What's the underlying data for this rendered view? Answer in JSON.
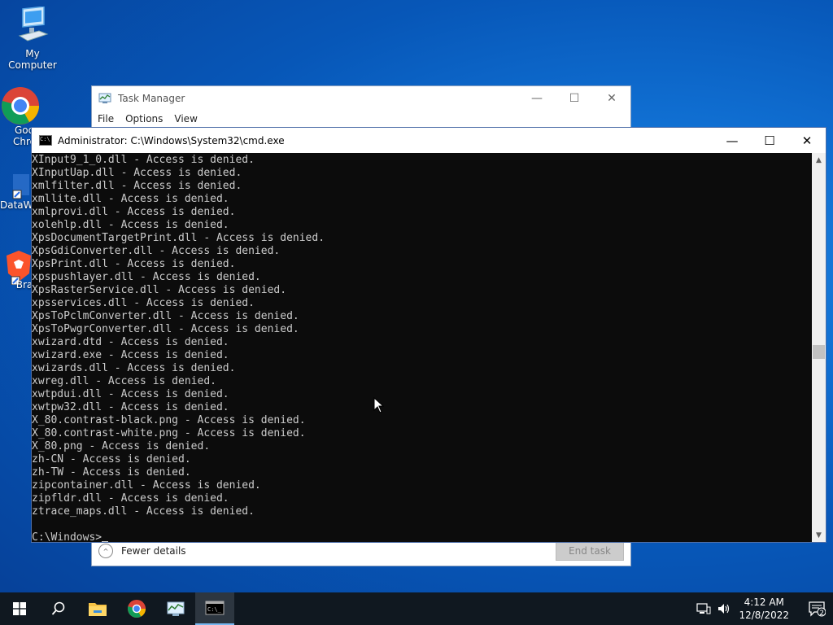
{
  "desktop": {
    "icons": [
      {
        "label": "My Computer",
        "icon": "computer-icon"
      },
      {
        "label": "Goo Chro",
        "icon": "chrome-icon"
      },
      {
        "label": "DataW",
        "icon": "datawrapper-icon"
      },
      {
        "label": "Bra",
        "icon": "brave-icon"
      }
    ]
  },
  "taskmgr": {
    "title": "Task Manager",
    "menu": [
      "File",
      "Options",
      "View"
    ],
    "fewer_details": "Fewer details",
    "end_task": "End task"
  },
  "cmd": {
    "title": "Administrator:  C:\\Windows\\System32\\cmd.exe",
    "lines": [
      "XInput9_1_0.dll - Access is denied.",
      "XInputUap.dll - Access is denied.",
      "xmlfilter.dll - Access is denied.",
      "xmllite.dll - Access is denied.",
      "xmlprovi.dll - Access is denied.",
      "xolehlp.dll - Access is denied.",
      "XpsDocumentTargetPrint.dll - Access is denied.",
      "XpsGdiConverter.dll - Access is denied.",
      "XpsPrint.dll - Access is denied.",
      "xpspushlayer.dll - Access is denied.",
      "XpsRasterService.dll - Access is denied.",
      "xpsservices.dll - Access is denied.",
      "XpsToPclmConverter.dll - Access is denied.",
      "XpsToPwgrConverter.dll - Access is denied.",
      "xwizard.dtd - Access is denied.",
      "xwizard.exe - Access is denied.",
      "xwizards.dll - Access is denied.",
      "xwreg.dll - Access is denied.",
      "xwtpdui.dll - Access is denied.",
      "xwtpw32.dll - Access is denied.",
      "X_80.contrast-black.png - Access is denied.",
      "X_80.contrast-white.png - Access is denied.",
      "X_80.png - Access is denied.",
      "zh-CN - Access is denied.",
      "zh-TW - Access is denied.",
      "zipcontainer.dll - Access is denied.",
      "zipfldr.dll - Access is denied.",
      "ztrace_maps.dll - Access is denied."
    ],
    "prompt": "C:\\Windows>"
  },
  "taskbar": {
    "items": [
      "start-icon",
      "search-icon",
      "file-explorer-icon",
      "chrome-icon",
      "task-manager-icon",
      "cmd-icon"
    ],
    "time": "4:12 AM",
    "date": "12/8/2022",
    "notifications": "2"
  }
}
